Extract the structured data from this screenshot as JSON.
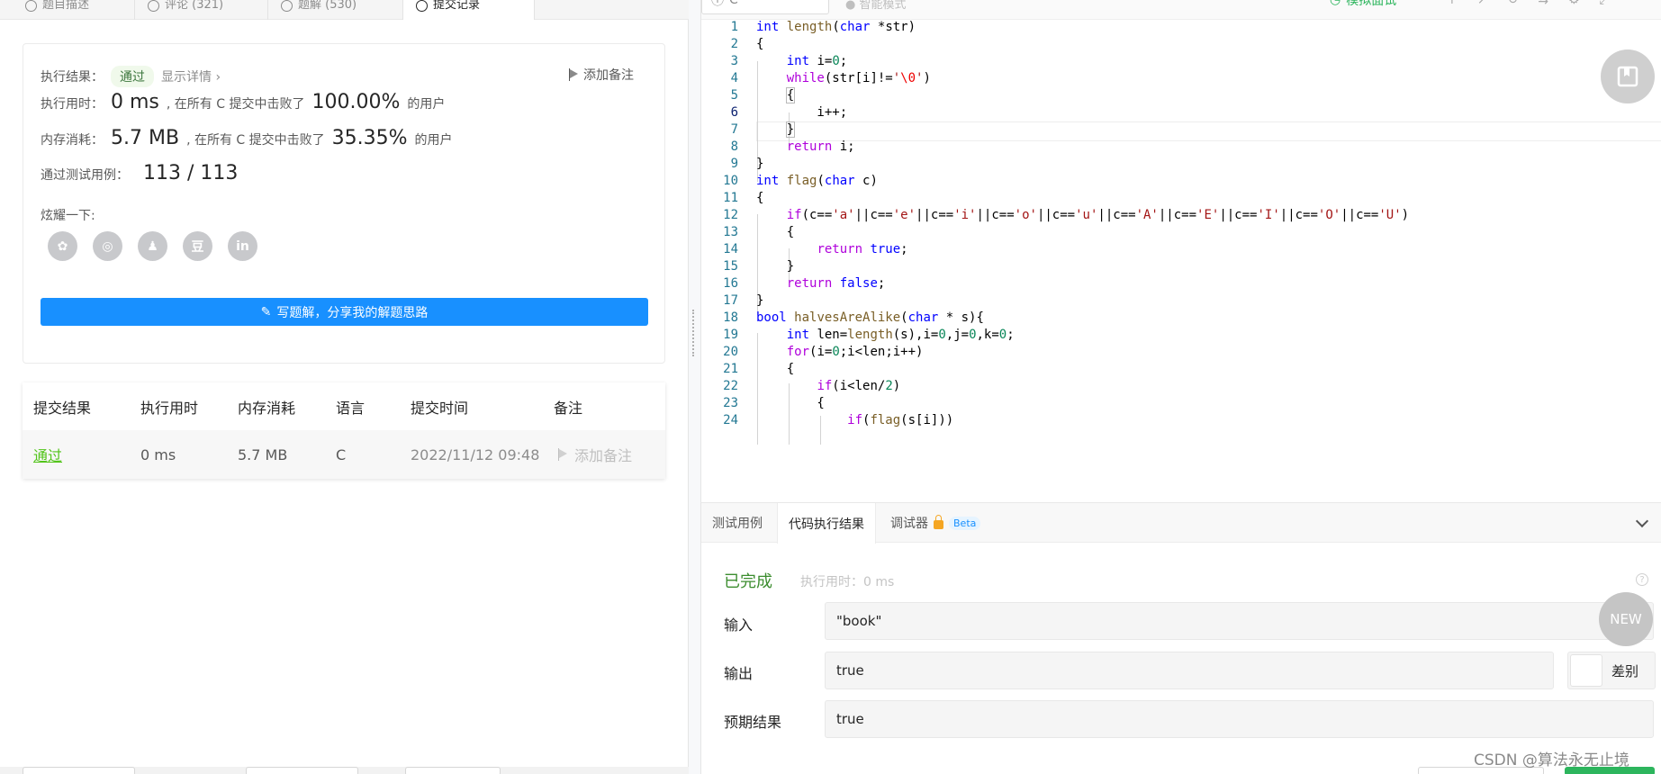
{
  "tabs": [
    {
      "label": "题目描述"
    },
    {
      "label": "评论 (321)"
    },
    {
      "label": "题解 (530)"
    },
    {
      "label": "提交记录"
    }
  ],
  "result": {
    "exec_label": "执行结果：",
    "status": "通过",
    "details_link": "显示详情 ›",
    "add_note": "添加备注",
    "time_label": "执行用时：",
    "time_value": "0 ms",
    "time_text": ", 在所有 C 提交中击败了",
    "time_pct": "100.00%",
    "users1": "的用户",
    "mem_label": "内存消耗：",
    "mem_value": "5.7 MB",
    "mem_text": ", 在所有 C 提交中击败了",
    "mem_pct": "35.35%",
    "users2": "的用户",
    "tests_label": "通过测试用例：",
    "tests_value": "113 / 113",
    "share_label": "炫耀一下:",
    "write_btn": "写题解，分享我的解题思路"
  },
  "share_icons": [
    "wechat-icon",
    "weibo-icon",
    "qq-icon",
    "douban-icon",
    "linkedin-icon"
  ],
  "share_glyphs": [
    "✿",
    "◎",
    "♟",
    "豆",
    "in"
  ],
  "submissions": {
    "headers": [
      "提交结果",
      "执行用时",
      "内存消耗",
      "语言",
      "提交时间",
      "备注"
    ],
    "rows": [
      {
        "status": "通过",
        "time": "0 ms",
        "memory": "5.7 MB",
        "lang": "C",
        "date": "2022/11/12 09:48",
        "note": "添加备注"
      }
    ]
  },
  "editor": {
    "language": "C",
    "smart_mode": "智能模式",
    "mock_label": "模拟面试"
  },
  "console": {
    "tabs": [
      "测试用例",
      "代码执行结果",
      "调试器"
    ],
    "beta": "Beta",
    "status": "已完成",
    "exec_time": "执行用时：0 ms",
    "input_label": "输入",
    "input_value": "\"book\"",
    "output_label": "输出",
    "output_value": "true",
    "diff_label": "差别",
    "expected_label": "预期结果",
    "expected_value": "true",
    "new_badge": "NEW"
  },
  "watermark": "CSDN @算法永无止境",
  "colors": {
    "accent": "#1890ff",
    "success": "#3c8d2f",
    "mock": "#2db55d"
  }
}
